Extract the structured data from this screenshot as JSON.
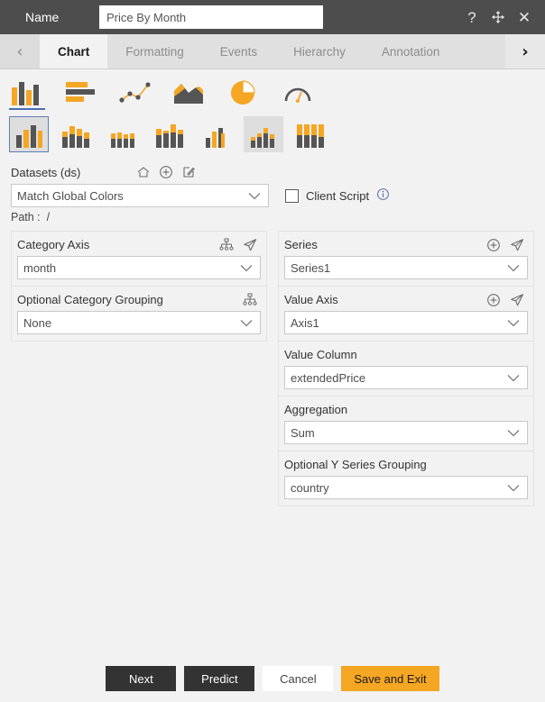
{
  "titlebar": {
    "name_label": "Name",
    "name_value": "Price By Month",
    "name_placeholder": "Name",
    "help_icon": "question-mark-icon",
    "move_icon": "move-icon",
    "close_icon": "close-icon",
    "help_glyph": "?",
    "move_glyph": "✥",
    "close_glyph": "✕"
  },
  "tabs": {
    "prev_glyph": "‹",
    "next_glyph": "›",
    "items": [
      {
        "label": "Chart",
        "active": true
      },
      {
        "label": "Formatting",
        "active": false
      },
      {
        "label": "Events",
        "active": false
      },
      {
        "label": "Hierarchy",
        "active": false
      },
      {
        "label": "Annotation",
        "active": false
      }
    ]
  },
  "chart_types": [
    {
      "name": "column-chart-icon",
      "selected": true
    },
    {
      "name": "bar-chart-icon",
      "selected": false
    },
    {
      "name": "scatter-line-chart-icon",
      "selected": false
    },
    {
      "name": "area-chart-icon",
      "selected": false
    },
    {
      "name": "pie-chart-icon",
      "selected": false
    },
    {
      "name": "gauge-chart-icon",
      "selected": false
    }
  ],
  "chart_subtypes": [
    {
      "name": "clustered-column-icon",
      "selected": true,
      "hover": false
    },
    {
      "name": "stacked-column-icon",
      "selected": false,
      "hover": false
    },
    {
      "name": "stacked-100-column-icon",
      "selected": false,
      "hover": false
    },
    {
      "name": "grouped-stacked-column-icon",
      "selected": false,
      "hover": false
    },
    {
      "name": "overlapped-column-icon",
      "selected": false,
      "hover": false
    },
    {
      "name": "waterfall-column-icon",
      "selected": false,
      "hover": true
    },
    {
      "name": "full-stacked-column-icon",
      "selected": false,
      "hover": false
    }
  ],
  "datasets": {
    "label": "Datasets (ds)",
    "home_icon": "home-icon",
    "add_icon": "plus-circle-icon",
    "edit_icon": "edit-pencil-icon",
    "select_value": "Match Global Colors",
    "client_script_label": "Client Script",
    "client_script_checked": false,
    "info_icon": "info-icon",
    "path_label": "Path :",
    "path_value": "/"
  },
  "left_column": {
    "category_axis": {
      "title": "Category Axis",
      "hierarchy_icon": "hierarchy-icon",
      "link_icon": "cursor-arrow-icon",
      "value": "month"
    },
    "category_grouping": {
      "title": "Optional Category Grouping",
      "hierarchy_icon": "hierarchy-icon",
      "value": "None"
    }
  },
  "right_column": {
    "series": {
      "title": "Series",
      "add_icon": "plus-circle-icon",
      "link_icon": "cursor-arrow-icon",
      "value": "Series1"
    },
    "value_axis": {
      "title": "Value Axis",
      "add_icon": "plus-circle-icon",
      "link_icon": "cursor-arrow-icon",
      "value": "Axis1"
    },
    "value_column": {
      "title": "Value Column",
      "value": "extendedPrice"
    },
    "aggregation": {
      "title": "Aggregation",
      "value": "Sum"
    },
    "y_series_grouping": {
      "title": "Optional Y Series Grouping",
      "value": "country"
    }
  },
  "footer": {
    "next_label": "Next",
    "predict_label": "Predict",
    "cancel_label": "Cancel",
    "save_label": "Save and Exit"
  },
  "colors": {
    "accent_orange": "#f5a623",
    "titlebar_bg": "#4d4d4d",
    "body_bg": "#f2f2f2",
    "selection_blue": "#5b7dbf",
    "dark_button": "#333333"
  }
}
